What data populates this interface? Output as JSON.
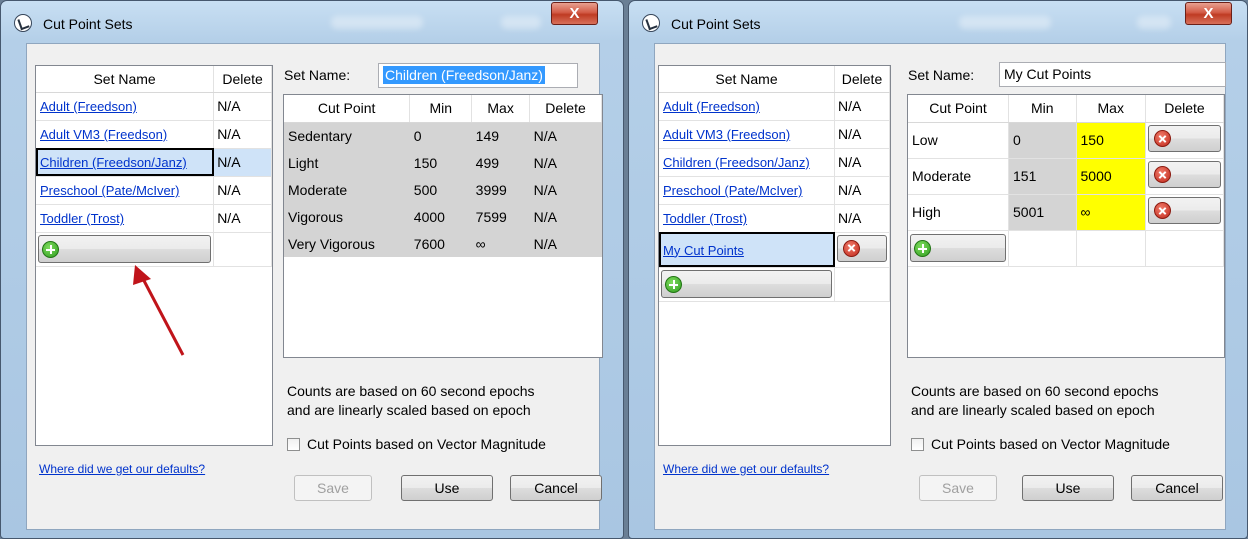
{
  "left": {
    "title": "Cut Point Sets",
    "close_label": "X",
    "set_list": {
      "headers": [
        "Set Name",
        "Delete"
      ],
      "rows": [
        {
          "name": "Adult (Freedson)",
          "delete": "N/A"
        },
        {
          "name": "Adult VM3 (Freedson)",
          "delete": "N/A"
        },
        {
          "name": "Children (Freedson/Janz)",
          "delete": "N/A"
        },
        {
          "name": "Preschool (Pate/McIver)",
          "delete": "N/A"
        },
        {
          "name": "Toddler (Trost)",
          "delete": "N/A"
        }
      ]
    },
    "set_name_label": "Set Name:",
    "set_name_value": "Children (Freedson/Janz)",
    "cut_points": {
      "headers": [
        "Cut Point",
        "Min",
        "Max",
        "Delete"
      ],
      "rows": [
        {
          "name": "Sedentary",
          "min": "0",
          "max": "149",
          "delete": "N/A"
        },
        {
          "name": "Light",
          "min": "150",
          "max": "499",
          "delete": "N/A"
        },
        {
          "name": "Moderate",
          "min": "500",
          "max": "3999",
          "delete": "N/A"
        },
        {
          "name": "Vigorous",
          "min": "4000",
          "max": "7599",
          "delete": "N/A"
        },
        {
          "name": "Very Vigorous",
          "min": "7600",
          "max": "∞",
          "delete": "N/A"
        }
      ]
    },
    "note_line1": "Counts are based on 60 second epochs",
    "note_line2": "and are linearly scaled based on epoch",
    "vm_label": "Cut Points based on Vector Magnitude",
    "defaults_link": "Where did we get our defaults?",
    "buttons": {
      "save": "Save",
      "use": "Use",
      "cancel": "Cancel"
    }
  },
  "right": {
    "title": "Cut Point Sets",
    "close_label": "X",
    "set_list": {
      "headers": [
        "Set Name",
        "Delete"
      ],
      "rows": [
        {
          "name": "Adult (Freedson)",
          "delete": "N/A"
        },
        {
          "name": "Adult VM3 (Freedson)",
          "delete": "N/A"
        },
        {
          "name": "Children (Freedson/Janz)",
          "delete": "N/A"
        },
        {
          "name": "Preschool (Pate/McIver)",
          "delete": "N/A"
        },
        {
          "name": "Toddler (Trost)",
          "delete": "N/A"
        },
        {
          "name": "My Cut Points",
          "delete": ""
        }
      ]
    },
    "set_name_label": "Set Name:",
    "set_name_value": "My Cut Points",
    "cut_points": {
      "headers": [
        "Cut Point",
        "Min",
        "Max",
        "Delete"
      ],
      "rows": [
        {
          "name": "Low",
          "min": "0",
          "max": "150"
        },
        {
          "name": "Moderate",
          "min": "151",
          "max": "5000"
        },
        {
          "name": "High",
          "min": "5001",
          "max": "∞"
        }
      ]
    },
    "note_line1": "Counts are based on 60 second epochs",
    "note_line2": "and are linearly scaled based on epoch",
    "vm_label": "Cut Points based on Vector Magnitude",
    "defaults_link": "Where did we get our defaults?",
    "buttons": {
      "save": "Save",
      "use": "Use",
      "cancel": "Cancel"
    }
  },
  "colors": {
    "highlight": "#ffff00",
    "selection": "#3399ff",
    "arrow": "#c0141a"
  }
}
